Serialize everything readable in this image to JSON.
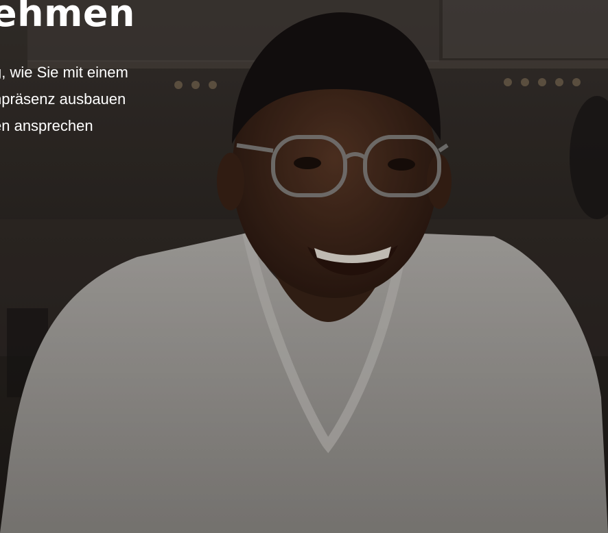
{
  "hero": {
    "headline": "ehmen",
    "subtext_lines": [
      "g, wie Sie mit einem",
      "npräsenz ausbauen",
      "en ansprechen"
    ]
  },
  "colors": {
    "text": "#ffffff",
    "overlay": "#000000",
    "shirt": "#a9a6a3",
    "skin": "#4a2e20"
  }
}
